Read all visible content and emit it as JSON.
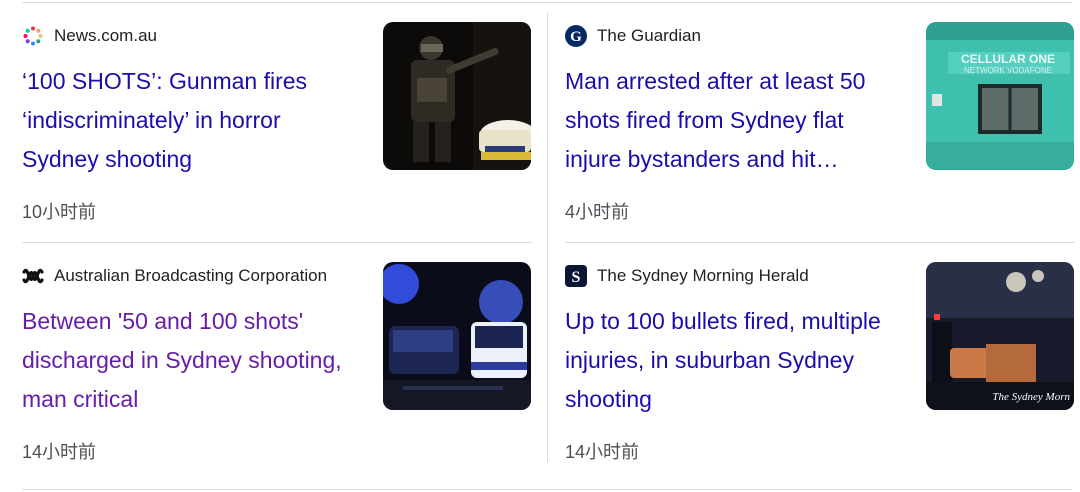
{
  "articles": [
    {
      "source": "News.com.au",
      "source_icon": "newscomau-dots-icon",
      "title": "‘100 SHOTS’: Gunman fires ‘indiscriminately’ in horror Sydney shooting",
      "time": "10小时前",
      "visited": false,
      "thumbnail": "armed-police-officer-at-night-image"
    },
    {
      "source": "The Guardian",
      "source_icon": "guardian-g-icon",
      "title": "Man arrested after at least 50 shots fired from Sydney flat injure bystanders and hit…",
      "time": "4小时前",
      "visited": false,
      "thumbnail": "teal-building-damaged-window-image"
    },
    {
      "source": "Australian Broadcasting Corporation",
      "source_icon": "abc-lissajous-icon",
      "title": "Between '50 and 100 shots' discharged in Sydney shooting, man critical",
      "time": "14小时前",
      "visited": true,
      "thumbnail": "police-cars-blue-lights-image"
    },
    {
      "source": "The Sydney Morning Herald",
      "source_icon": "smh-s-icon",
      "title": "Up to 100 bullets fired, multiple injuries, in suburban Sydney shooting",
      "time": "14小时前",
      "visited": false,
      "thumbnail": "night-street-police-scene-image"
    }
  ],
  "thumbnail_text": {
    "guardian_sign": "CELLULAR ONE",
    "guardian_sign_small": "NETWORK VODAFONE",
    "smh_watermark": "The Sydney Morn"
  },
  "colors": {
    "title_link": "#1a0dab",
    "title_visited": "#681da8",
    "meta": "#4d5156",
    "divider": "#dadce0"
  }
}
